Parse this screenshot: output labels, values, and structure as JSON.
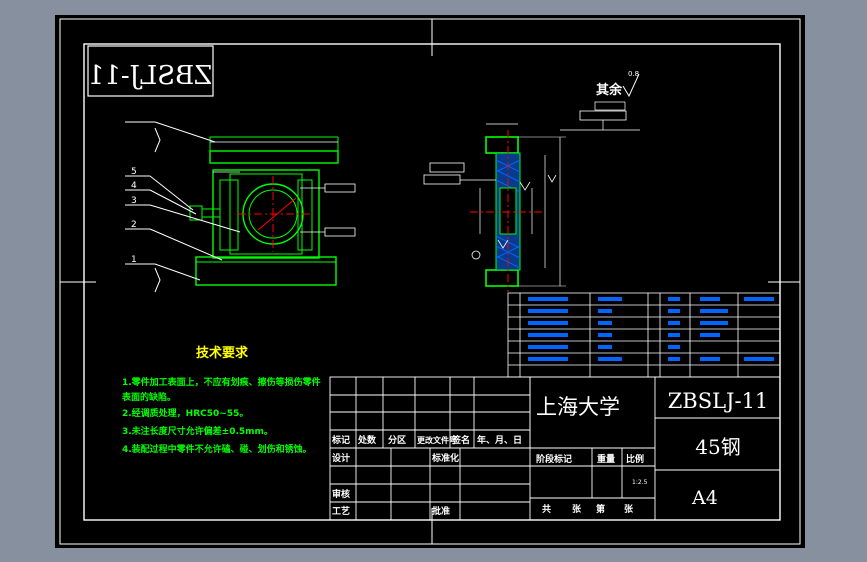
{
  "drawing_code": "ZBSLJ-11",
  "mirrored_code": "ZBSLJ-11",
  "roughness_note": "其余",
  "roughness_value": "0.8",
  "tech_requirements": {
    "title": "技术要求",
    "lines": [
      "1.零件加工表面上，不应有划痕、擦伤等损伤零件",
      "表面的缺陷。",
      "2.经调质处理，HRC50~55。",
      "3.未注长度尺寸允许偏差±0.5mm。",
      "4.装配过程中零件不允许磕、碰、划伤和锈蚀。"
    ]
  },
  "title_block": {
    "school": "上海大学",
    "code": "ZBSLJ-11",
    "material": "45钢",
    "sheet_size": "A4",
    "scale": "1:2.5",
    "labels": {
      "mark": "标记",
      "count": "处数",
      "zone": "分区",
      "change_doc": "更改文件号",
      "sign": "签名",
      "date": "年、月、日",
      "design": "设计",
      "standardize": "标准化",
      "review": "审核",
      "process": "工艺",
      "approve": "批准",
      "stage_mark": "阶段标记",
      "weight": "重量",
      "ratio": "比例",
      "total": "共",
      "sheets": "张",
      "page": "第",
      "sheet": "张"
    }
  },
  "balloons": [
    "5",
    "4",
    "3",
    "2",
    "1"
  ],
  "side_balloon": "1",
  "colors": {
    "background": "#87909e",
    "sheet": "#000000",
    "frame": "#ffffff",
    "outline": "#00ff00",
    "center": "#ff0000",
    "hatch": "#0066ff",
    "leader": "#ffffff",
    "text_yellow": "#ffff00",
    "text_green": "#00ff00"
  }
}
